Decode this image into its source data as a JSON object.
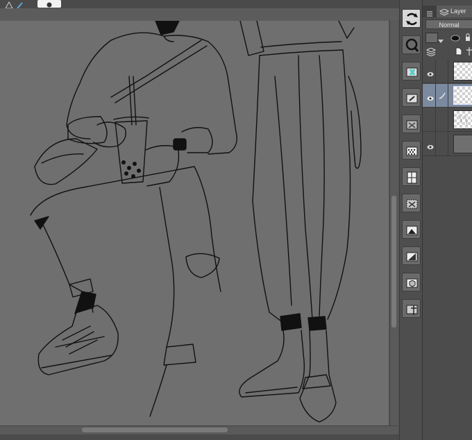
{
  "window": {
    "title": ""
  },
  "layer_panel": {
    "tab_label": "Layer",
    "blend_mode": "Normal",
    "layers": [
      {
        "visible": true,
        "selected": false,
        "thumbnail": "transparent"
      },
      {
        "visible": true,
        "selected": true,
        "thumbnail": "transparent"
      },
      {
        "visible": false,
        "selected": false,
        "thumbnail": "sketch"
      },
      {
        "visible": true,
        "selected": false,
        "thumbnail": "gray-fill"
      }
    ]
  },
  "tools": [
    "convert-layer-icon",
    "zoom-icon",
    "new-raster-layer-icon",
    "new-vector-layer-icon",
    "clear-layer-icon",
    "new-tone-icon",
    "frame-border-icon",
    "selection-to-layer-icon",
    "image-material-icon",
    "gradient-map-icon",
    "3d-material-icon",
    "ruler-icon"
  ],
  "colors": {
    "canvas": "#6f6f6f",
    "ui_dark": "#4c4c4c",
    "selected_layer": "#7c8aa0"
  }
}
